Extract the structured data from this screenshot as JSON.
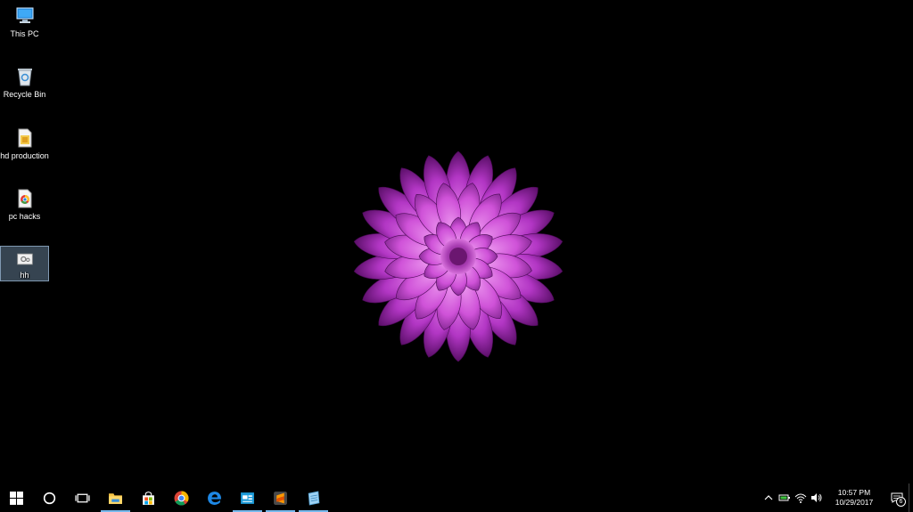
{
  "desktop": {
    "icons": [
      {
        "label": "This PC",
        "icon": "computer-icon"
      },
      {
        "label": "Recycle Bin",
        "icon": "recycle-bin-icon"
      },
      {
        "label": "hd production",
        "icon": "file-icon"
      },
      {
        "label": "pc hacks",
        "icon": "chrome-shortcut-icon"
      },
      {
        "label": "hh",
        "icon": "settings-file-icon"
      }
    ],
    "selected_icon": "hh"
  },
  "taskbar": {
    "buttons": [
      {
        "name": "start",
        "icon": "windows-logo-icon"
      },
      {
        "name": "search",
        "icon": "cortana-circle-icon"
      },
      {
        "name": "task-view",
        "icon": "task-view-icon"
      },
      {
        "name": "file-explorer",
        "icon": "folder-icon",
        "running": true
      },
      {
        "name": "store",
        "icon": "store-bag-icon"
      },
      {
        "name": "chrome",
        "icon": "chrome-icon"
      },
      {
        "name": "edge",
        "icon": "edge-icon"
      },
      {
        "name": "app-1",
        "icon": "app-window-icon",
        "running": true
      },
      {
        "name": "sublime",
        "icon": "sublime-text-icon",
        "running": true
      },
      {
        "name": "app-2",
        "icon": "notepad-icon",
        "running": true
      }
    ],
    "tray": {
      "icons": [
        "chevron-up-icon",
        "battery-icon",
        "wifi-icon",
        "volume-icon"
      ],
      "time": "10:57 PM",
      "date": "10/29/2017",
      "notification_count": "6"
    }
  },
  "colors": {
    "accent": "#76b9ed",
    "flower": "#c13fcf"
  }
}
